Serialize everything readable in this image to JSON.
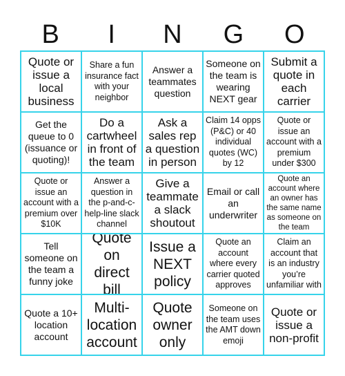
{
  "header": {
    "letters": [
      "B",
      "I",
      "N",
      "G",
      "O"
    ]
  },
  "colors": {
    "grid_border": "#36d3ea",
    "text": "#111111",
    "background": "#ffffff"
  },
  "board": {
    "cells": [
      "Quote or issue a local business",
      "Share a fun insurance fact with your neighbor",
      "Answer a teammates question",
      "Someone on the team is wearing NEXT gear",
      "Submit a quote in each carrier",
      "Get the queue to 0 (issuance or quoting)!",
      "Do a cartwheel in front of the team",
      "Ask a sales rep a question in person",
      "Claim 14 opps (P&C) or 40 individual quotes (WC) by 12",
      "Quote or issue an account with a premium under $300",
      "Quote or issue an account with a premium over $10K",
      "Answer a question in the p-and-c-help-line slack channel",
      "Give a teammate a slack shoutout",
      "Email or call an underwriter",
      "Quote an account where an owner has the same name as someone on the team",
      "Tell someone on the team a funny joke",
      "Quote on direct bill",
      "Issue a NEXT policy",
      "Quote an account where every carrier quoted approves",
      "Claim an account that is an industry you’re unfamiliar with",
      "Quote a 10+ location account",
      "Multi-location account",
      "Quote owner only",
      "Someone on the team uses the AMT down emoji",
      "Quote or issue a non-profit"
    ]
  }
}
